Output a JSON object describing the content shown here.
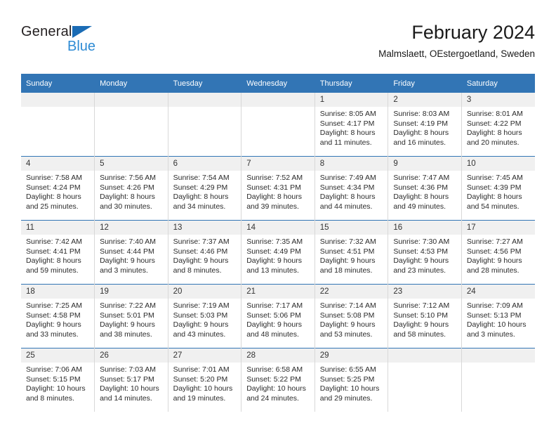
{
  "brand": {
    "line1": "General",
    "line2": "Blue",
    "triangle_color": "#1b6cb5",
    "blue_text_color": "#2e8bd4"
  },
  "header": {
    "title": "February 2024",
    "subtitle": "Malmslaett, OEstergoetland, Sweden"
  },
  "theme": {
    "header_blue": "#3275b5",
    "daynum_band": "#f0f0f0",
    "grid_line": "#d8d8d8"
  },
  "weekday_headers": [
    "Sunday",
    "Monday",
    "Tuesday",
    "Wednesday",
    "Thursday",
    "Friday",
    "Saturday"
  ],
  "weeks": [
    [
      {
        "day": "",
        "lines": []
      },
      {
        "day": "",
        "lines": []
      },
      {
        "day": "",
        "lines": []
      },
      {
        "day": "",
        "lines": []
      },
      {
        "day": "1",
        "lines": [
          "Sunrise: 8:05 AM",
          "Sunset: 4:17 PM",
          "Daylight: 8 hours",
          "and 11 minutes."
        ]
      },
      {
        "day": "2",
        "lines": [
          "Sunrise: 8:03 AM",
          "Sunset: 4:19 PM",
          "Daylight: 8 hours",
          "and 16 minutes."
        ]
      },
      {
        "day": "3",
        "lines": [
          "Sunrise: 8:01 AM",
          "Sunset: 4:22 PM",
          "Daylight: 8 hours",
          "and 20 minutes."
        ]
      }
    ],
    [
      {
        "day": "4",
        "lines": [
          "Sunrise: 7:58 AM",
          "Sunset: 4:24 PM",
          "Daylight: 8 hours",
          "and 25 minutes."
        ]
      },
      {
        "day": "5",
        "lines": [
          "Sunrise: 7:56 AM",
          "Sunset: 4:26 PM",
          "Daylight: 8 hours",
          "and 30 minutes."
        ]
      },
      {
        "day": "6",
        "lines": [
          "Sunrise: 7:54 AM",
          "Sunset: 4:29 PM",
          "Daylight: 8 hours",
          "and 34 minutes."
        ]
      },
      {
        "day": "7",
        "lines": [
          "Sunrise: 7:52 AM",
          "Sunset: 4:31 PM",
          "Daylight: 8 hours",
          "and 39 minutes."
        ]
      },
      {
        "day": "8",
        "lines": [
          "Sunrise: 7:49 AM",
          "Sunset: 4:34 PM",
          "Daylight: 8 hours",
          "and 44 minutes."
        ]
      },
      {
        "day": "9",
        "lines": [
          "Sunrise: 7:47 AM",
          "Sunset: 4:36 PM",
          "Daylight: 8 hours",
          "and 49 minutes."
        ]
      },
      {
        "day": "10",
        "lines": [
          "Sunrise: 7:45 AM",
          "Sunset: 4:39 PM",
          "Daylight: 8 hours",
          "and 54 minutes."
        ]
      }
    ],
    [
      {
        "day": "11",
        "lines": [
          "Sunrise: 7:42 AM",
          "Sunset: 4:41 PM",
          "Daylight: 8 hours",
          "and 59 minutes."
        ]
      },
      {
        "day": "12",
        "lines": [
          "Sunrise: 7:40 AM",
          "Sunset: 4:44 PM",
          "Daylight: 9 hours",
          "and 3 minutes."
        ]
      },
      {
        "day": "13",
        "lines": [
          "Sunrise: 7:37 AM",
          "Sunset: 4:46 PM",
          "Daylight: 9 hours",
          "and 8 minutes."
        ]
      },
      {
        "day": "14",
        "lines": [
          "Sunrise: 7:35 AM",
          "Sunset: 4:49 PM",
          "Daylight: 9 hours",
          "and 13 minutes."
        ]
      },
      {
        "day": "15",
        "lines": [
          "Sunrise: 7:32 AM",
          "Sunset: 4:51 PM",
          "Daylight: 9 hours",
          "and 18 minutes."
        ]
      },
      {
        "day": "16",
        "lines": [
          "Sunrise: 7:30 AM",
          "Sunset: 4:53 PM",
          "Daylight: 9 hours",
          "and 23 minutes."
        ]
      },
      {
        "day": "17",
        "lines": [
          "Sunrise: 7:27 AM",
          "Sunset: 4:56 PM",
          "Daylight: 9 hours",
          "and 28 minutes."
        ]
      }
    ],
    [
      {
        "day": "18",
        "lines": [
          "Sunrise: 7:25 AM",
          "Sunset: 4:58 PM",
          "Daylight: 9 hours",
          "and 33 minutes."
        ]
      },
      {
        "day": "19",
        "lines": [
          "Sunrise: 7:22 AM",
          "Sunset: 5:01 PM",
          "Daylight: 9 hours",
          "and 38 minutes."
        ]
      },
      {
        "day": "20",
        "lines": [
          "Sunrise: 7:19 AM",
          "Sunset: 5:03 PM",
          "Daylight: 9 hours",
          "and 43 minutes."
        ]
      },
      {
        "day": "21",
        "lines": [
          "Sunrise: 7:17 AM",
          "Sunset: 5:06 PM",
          "Daylight: 9 hours",
          "and 48 minutes."
        ]
      },
      {
        "day": "22",
        "lines": [
          "Sunrise: 7:14 AM",
          "Sunset: 5:08 PM",
          "Daylight: 9 hours",
          "and 53 minutes."
        ]
      },
      {
        "day": "23",
        "lines": [
          "Sunrise: 7:12 AM",
          "Sunset: 5:10 PM",
          "Daylight: 9 hours",
          "and 58 minutes."
        ]
      },
      {
        "day": "24",
        "lines": [
          "Sunrise: 7:09 AM",
          "Sunset: 5:13 PM",
          "Daylight: 10 hours",
          "and 3 minutes."
        ]
      }
    ],
    [
      {
        "day": "25",
        "lines": [
          "Sunrise: 7:06 AM",
          "Sunset: 5:15 PM",
          "Daylight: 10 hours",
          "and 8 minutes."
        ]
      },
      {
        "day": "26",
        "lines": [
          "Sunrise: 7:03 AM",
          "Sunset: 5:17 PM",
          "Daylight: 10 hours",
          "and 14 minutes."
        ]
      },
      {
        "day": "27",
        "lines": [
          "Sunrise: 7:01 AM",
          "Sunset: 5:20 PM",
          "Daylight: 10 hours",
          "and 19 minutes."
        ]
      },
      {
        "day": "28",
        "lines": [
          "Sunrise: 6:58 AM",
          "Sunset: 5:22 PM",
          "Daylight: 10 hours",
          "and 24 minutes."
        ]
      },
      {
        "day": "29",
        "lines": [
          "Sunrise: 6:55 AM",
          "Sunset: 5:25 PM",
          "Daylight: 10 hours",
          "and 29 minutes."
        ]
      },
      {
        "day": "",
        "lines": []
      },
      {
        "day": "",
        "lines": []
      }
    ]
  ]
}
